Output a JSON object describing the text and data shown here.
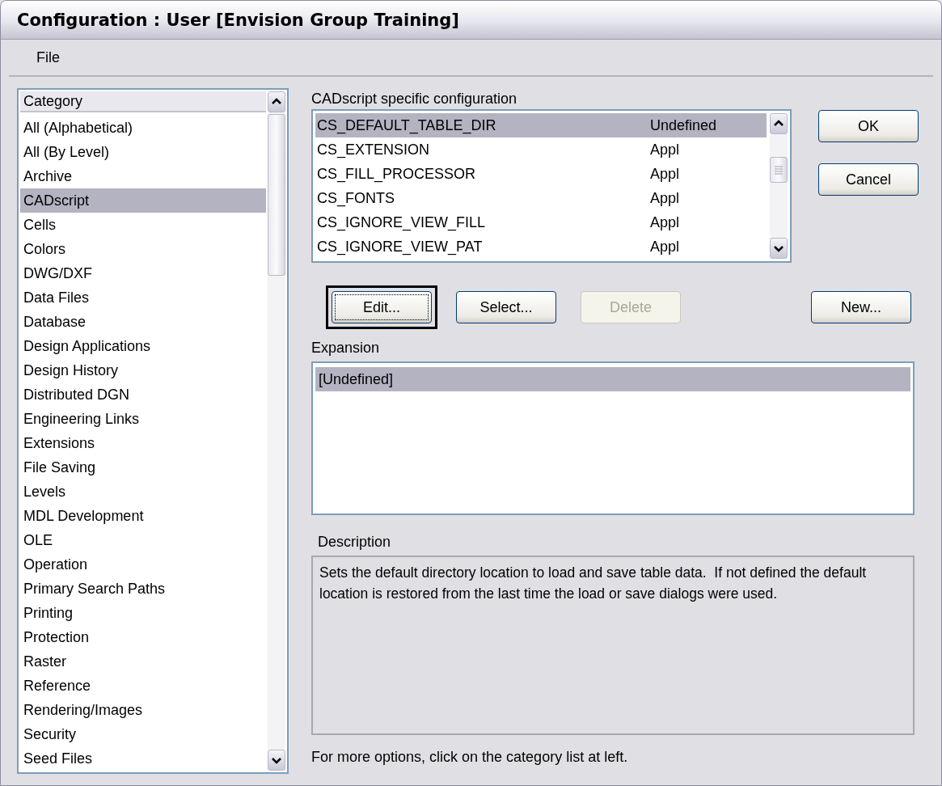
{
  "window": {
    "title": "Configuration : User [Envision Group Training]"
  },
  "menu": [
    {
      "label": "File"
    }
  ],
  "category_list": {
    "header": "Category",
    "items": [
      {
        "label": "All (Alphabetical)",
        "selected": false
      },
      {
        "label": "All (By Level)",
        "selected": false
      },
      {
        "label": "Archive",
        "selected": false
      },
      {
        "label": "CADscript",
        "selected": true
      },
      {
        "label": "Cells",
        "selected": false
      },
      {
        "label": "Colors",
        "selected": false
      },
      {
        "label": "DWG/DXF",
        "selected": false
      },
      {
        "label": "Data Files",
        "selected": false
      },
      {
        "label": "Database",
        "selected": false
      },
      {
        "label": "Design Applications",
        "selected": false
      },
      {
        "label": "Design History",
        "selected": false
      },
      {
        "label": "Distributed DGN",
        "selected": false
      },
      {
        "label": "Engineering Links",
        "selected": false
      },
      {
        "label": "Extensions",
        "selected": false
      },
      {
        "label": "File Saving",
        "selected": false
      },
      {
        "label": "Levels",
        "selected": false
      },
      {
        "label": "MDL Development",
        "selected": false
      },
      {
        "label": "OLE",
        "selected": false
      },
      {
        "label": "Operation",
        "selected": false
      },
      {
        "label": "Primary Search Paths",
        "selected": false
      },
      {
        "label": "Printing",
        "selected": false
      },
      {
        "label": "Protection",
        "selected": false
      },
      {
        "label": "Raster",
        "selected": false
      },
      {
        "label": "Reference",
        "selected": false
      },
      {
        "label": "Rendering/Images",
        "selected": false
      },
      {
        "label": "Security",
        "selected": false
      },
      {
        "label": "Seed Files",
        "selected": false
      }
    ]
  },
  "variables": {
    "label": "CADscript specific configuration",
    "rows": [
      {
        "name": "CS_DEFAULT_TABLE_DIR",
        "level": "Undefined",
        "selected": true
      },
      {
        "name": "CS_EXTENSION",
        "level": "Appl",
        "selected": false
      },
      {
        "name": "CS_FILL_PROCESSOR",
        "level": "Appl",
        "selected": false
      },
      {
        "name": "CS_FONTS",
        "level": "Appl",
        "selected": false
      },
      {
        "name": "CS_IGNORE_VIEW_FILL",
        "level": "Appl",
        "selected": false
      },
      {
        "name": "CS_IGNORE_VIEW_PAT",
        "level": "Appl",
        "selected": false
      }
    ]
  },
  "side_buttons": [
    {
      "label": "OK",
      "disabled": false,
      "focused": false
    },
    {
      "label": "Cancel",
      "disabled": false,
      "focused": false
    }
  ],
  "action_buttons": [
    {
      "label": "Edit...",
      "disabled": false,
      "focused": true
    },
    {
      "label": "Select...",
      "disabled": false,
      "focused": false
    },
    {
      "label": "Delete",
      "disabled": true,
      "focused": false
    }
  ],
  "new_button": {
    "label": "New...",
    "disabled": false,
    "focused": false
  },
  "expansion": {
    "label": "Expansion",
    "items": [
      {
        "label": "[Undefined]",
        "selected": true
      }
    ]
  },
  "description": {
    "label": "Description",
    "text": "Sets the default directory location to load and save table data.  If not defined the default location is restored from the last time the load or save dialogs were used."
  },
  "status_text": "For more options, click on the category list at left."
}
